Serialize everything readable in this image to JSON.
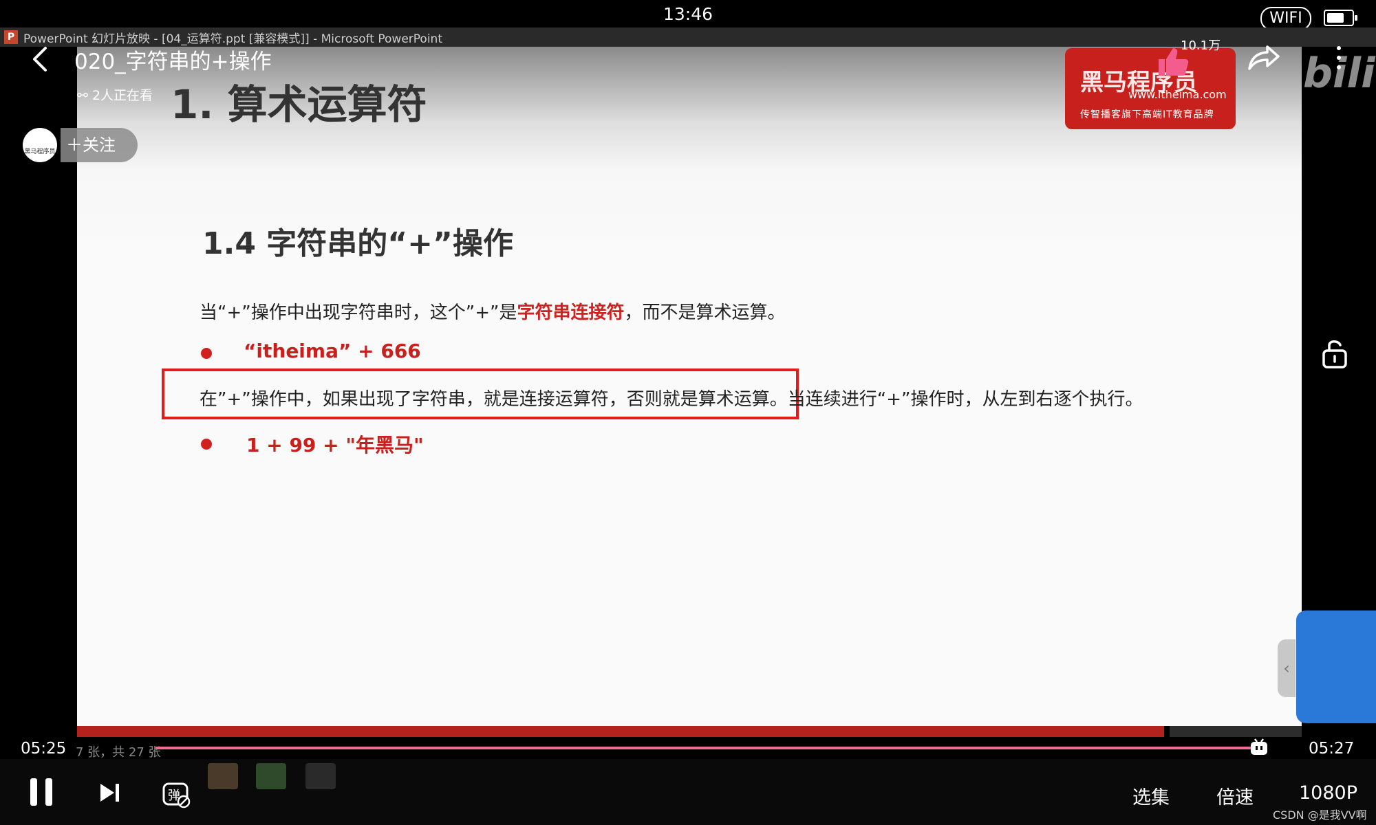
{
  "status_bar": {
    "time": "13:46",
    "wifi_label": "WIFI",
    "battery_level": 0.7
  },
  "ppt_window": {
    "app_icon": "P",
    "title": "PowerPoint 幻灯片放映 - [04_运算符.ppt [兼容模式]] - Microsoft PowerPoint"
  },
  "video": {
    "title": "020_字符串的+操作",
    "viewers": "2人正在看",
    "follow_label": "关注",
    "avatar_text": "黑马程序员",
    "like_count": "10.1万",
    "progress_fraction": 0.993,
    "time_current": "05:25",
    "time_total": "05:27",
    "slide_counter": "7 张，共 27 张"
  },
  "slide": {
    "header": "1. 算术运算符",
    "logo_main": "黑马程序员",
    "logo_url": "www.itheima.com",
    "logo_slogan": "传智播客旗下高端IT教育品牌",
    "section_title": "1.4 字符串的“+”操作",
    "line1_a": "当“+”操作中出现字符串时，这个”+”是",
    "line1_highlight": "字符串连接符",
    "line1_b": "，而不是算术运算。",
    "bullet1": "“itheima” + 666",
    "line2_boxed": "在”+”操作中，如果出现了字符串，就是连接运算符，否则就是算术运算。",
    "line2_rest": "当连续进行“+”操作时，从左到右逐个执行。",
    "bullet2": "1 + 99 + \"年黑马\""
  },
  "controls": {
    "episodes_label": "选集",
    "speed_label": "倍速",
    "quality_label": "1080P",
    "danmaku_label": "弹"
  },
  "watermark": {
    "bili": "bili",
    "csdn": "CSDN @是我VV啊"
  },
  "colors": {
    "accent_red": "#d12020",
    "progress_pink": "#f06b94",
    "like_pink": "#f25d8e",
    "side_panel_blue": "#2a78d8"
  }
}
